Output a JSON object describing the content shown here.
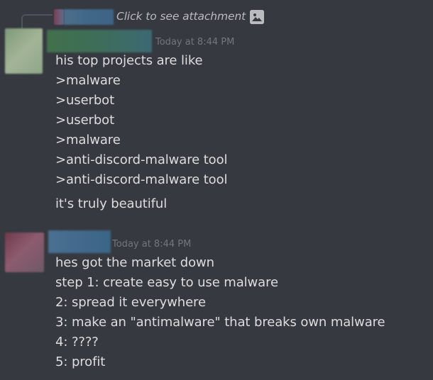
{
  "reply_preview": {
    "text": "Click to see attachment",
    "icon": "image-icon"
  },
  "messages": [
    {
      "timestamp": "Today at 8:44 PM",
      "lines": [
        "his top projects are like",
        ">malware",
        ">userbot",
        ">userbot",
        ">malware",
        ">anti-discord-malware tool",
        ">anti-discord-malware tool"
      ],
      "followup": "it's truly beautiful"
    },
    {
      "timestamp": "Today at 8:44 PM",
      "lines": [
        "hes got the market down",
        "step 1: create easy to use malware",
        "2: spread it everywhere",
        "3: make an \"antimalware\" that breaks own malware",
        "4: ????",
        "5: profit"
      ]
    }
  ],
  "colors": {
    "background": "#36393f",
    "text": "#dcddde",
    "muted": "#72767d"
  }
}
